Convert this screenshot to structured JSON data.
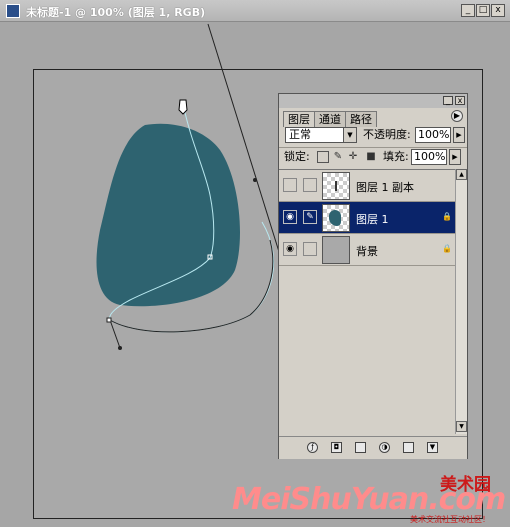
{
  "window": {
    "title": "未标题-1 @ 100% (图层 1, RGB)",
    "minimize": "_",
    "maximize": "□",
    "close": "x"
  },
  "layers_panel": {
    "tabs": [
      "图层",
      "通道",
      "路径"
    ],
    "blend_mode": "正常",
    "opacity_label": "不透明度:",
    "opacity_value": "100%",
    "lock_label": "锁定:",
    "fill_label": "填充:",
    "fill_value": "100%",
    "layers": [
      {
        "name": "图层 1 副本",
        "visible": false,
        "selected": false
      },
      {
        "name": "图层 1",
        "visible": true,
        "selected": true
      },
      {
        "name": "背景",
        "visible": true,
        "selected": false
      }
    ]
  },
  "watermark": {
    "top": "美术园",
    "main": "MeiShuYuan.com",
    "sub": "美术交流社互动社区！"
  },
  "colors": {
    "shape_fill": "#2e6370",
    "selection": "#0a246a"
  }
}
